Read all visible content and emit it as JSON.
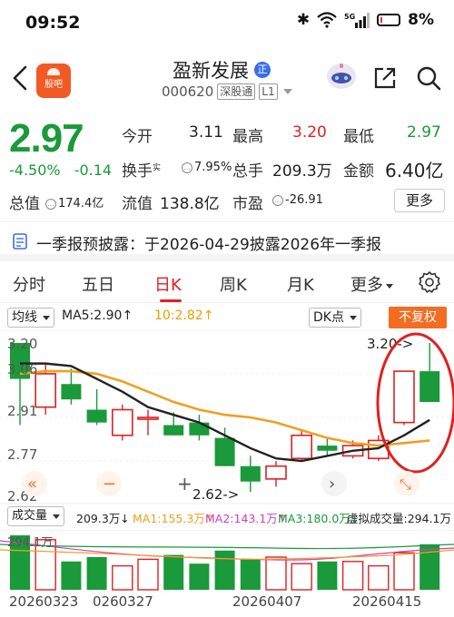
{
  "status": {
    "time": "09:52",
    "network": "5G",
    "battery": "8%"
  },
  "header": {
    "app_logo_text": "股吧",
    "stock_name": "盈新发展",
    "badge": "正",
    "stock_code": "000620",
    "connect_tag": "深股通",
    "level_tag": "L1"
  },
  "quote": {
    "price": "2.97",
    "change_pct": "-4.50%",
    "change_abs": "-0.14",
    "labels": {
      "open": "今开",
      "high": "最高",
      "low": "最低",
      "turnover": "换手",
      "turnover_sup": "实",
      "volume": "总手",
      "amount": "金额",
      "mkt_cap": "总值",
      "float_cap": "流值",
      "pe": "市盈"
    },
    "values": {
      "open": "3.11",
      "high": "3.20",
      "low": "2.97",
      "turnover": "7.95%",
      "volume": "209.3万",
      "amount": "6.40亿",
      "mkt_cap": "174.4亿",
      "float_cap": "138.8亿",
      "pe": "-26.91"
    },
    "more": "更多"
  },
  "notice": {
    "text": "一季报预披露：于2026-04-29披露2026年一季报"
  },
  "tabs": [
    "分时",
    "五日",
    "日K",
    "周K",
    "月K",
    "更多"
  ],
  "active_tab": "日K",
  "indicators": {
    "ma_select": "均线",
    "ma5": "MA5:2.90↑",
    "ma10": "10:2.82↑",
    "dk_select": "DK点",
    "adjust": "不复权"
  },
  "chart_labels": {
    "y_ticks": [
      "3.20",
      "3.06",
      "2.91",
      "2.77",
      "2.62"
    ],
    "high_marker": "3.20->",
    "low_marker": "2.62->",
    "controls": [
      "«",
      "−",
      "+",
      "›",
      "⤡"
    ]
  },
  "volume": {
    "select": "成交量",
    "vol": "209.3万↓",
    "ma1": "MA1:155.3万↑",
    "ma2": "MA2:143.1万↑",
    "ma3": "MA3:180.0万↓",
    "virtual": "虚拟成交量:294.1万",
    "max_label": "294.1万"
  },
  "dates": [
    "20260323",
    "0260327",
    "20260407",
    "20260415"
  ],
  "colors": {
    "up": "#e02020",
    "down": "#1a9a3a",
    "accent": "#f36c21",
    "ma5": "#222222",
    "ma10": "#f0a020"
  },
  "chart_data": {
    "type": "candlestick",
    "candles": [
      {
        "o": 3.2,
        "c": 3.06,
        "h": 3.2,
        "l": 2.88
      },
      {
        "o": 2.95,
        "c": 3.08,
        "h": 3.12,
        "l": 2.92
      },
      {
        "o": 3.04,
        "c": 2.98,
        "h": 3.1,
        "l": 2.96
      },
      {
        "o": 2.94,
        "c": 2.89,
        "h": 3.02,
        "l": 2.88
      },
      {
        "o": 2.84,
        "c": 2.94,
        "h": 2.96,
        "l": 2.82
      },
      {
        "o": 2.91,
        "c": 2.91,
        "h": 2.94,
        "l": 2.84
      },
      {
        "o": 2.88,
        "c": 2.84,
        "h": 2.93,
        "l": 2.84
      },
      {
        "o": 2.89,
        "c": 2.84,
        "h": 2.92,
        "l": 2.82
      },
      {
        "o": 2.83,
        "c": 2.72,
        "h": 2.87,
        "l": 2.72
      },
      {
        "o": 2.72,
        "c": 2.66,
        "h": 2.76,
        "l": 2.62
      },
      {
        "o": 2.67,
        "c": 2.72,
        "h": 2.74,
        "l": 2.64
      },
      {
        "o": 2.75,
        "c": 2.84,
        "h": 2.86,
        "l": 2.74
      },
      {
        "o": 2.8,
        "c": 2.78,
        "h": 2.83,
        "l": 2.76
      },
      {
        "o": 2.76,
        "c": 2.8,
        "h": 2.82,
        "l": 2.75
      },
      {
        "o": 2.75,
        "c": 2.82,
        "h": 2.84,
        "l": 2.74
      },
      {
        "o": 2.89,
        "c": 3.09,
        "h": 3.09,
        "l": 2.88
      },
      {
        "o": 3.09,
        "c": 2.97,
        "h": 3.2,
        "l": 2.97
      }
    ],
    "ma5": [
      3.12,
      3.12,
      3.11,
      3.06,
      3.01,
      2.95,
      2.92,
      2.89,
      2.84,
      2.79,
      2.75,
      2.74,
      2.76,
      2.78,
      2.79,
      2.84,
      2.9
    ],
    "ma10": [
      3.08,
      3.09,
      3.09,
      3.08,
      3.05,
      3.01,
      2.97,
      2.94,
      2.92,
      2.91,
      2.89,
      2.86,
      2.83,
      2.81,
      2.8,
      2.81,
      2.82
    ],
    "volumes": [
      250,
      230,
      130,
      150,
      110,
      140,
      160,
      120,
      180,
      140,
      150,
      120,
      130,
      130,
      110,
      170,
      209
    ],
    "y_range": [
      2.62,
      3.2
    ]
  }
}
